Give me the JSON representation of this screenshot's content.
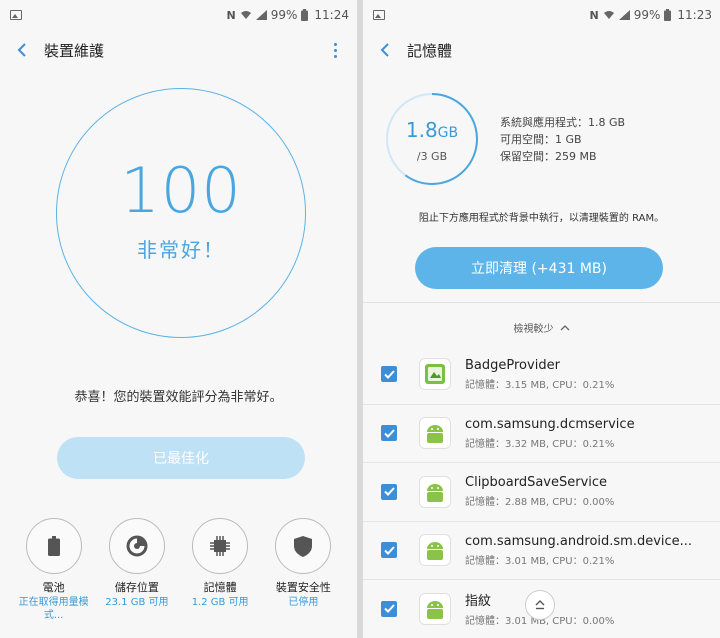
{
  "left": {
    "status": {
      "battery_pct": "99%",
      "time": "11:24"
    },
    "title": "裝置維護",
    "score": "100",
    "score_word": "非常好！",
    "congrats": "恭喜！您的裝置效能評分為非常好。",
    "optimize_label": "已最佳化",
    "categories": [
      {
        "label": "電池",
        "sub": "正在取得用量模式...",
        "icon": "battery-icon"
      },
      {
        "label": "儲存位置",
        "sub": "23.1 GB 可用",
        "icon": "storage-icon"
      },
      {
        "label": "記憶體",
        "sub": "1.2 GB 可用",
        "icon": "memory-chip-icon"
      },
      {
        "label": "裝置安全性",
        "sub": "已停用",
        "icon": "shield-icon"
      }
    ]
  },
  "right": {
    "status": {
      "battery_pct": "99%",
      "time": "11:23"
    },
    "title": "記憶體",
    "used_value": "1.8",
    "used_unit": "GB",
    "total": "/3 GB",
    "used_fraction": 0.6,
    "info": [
      "系統與應用程式：1.8 GB",
      "可用空間：1 GB",
      "保留空間：259 MB"
    ],
    "note": "阻止下方應用程式於背景中執行，以清理裝置的 RAM。",
    "clean_label": "立即清理 (+431 MB)",
    "view_less": "檢視較少",
    "apps": [
      {
        "name": "BadgeProvider",
        "detail": "記憶體：3.15 MB, CPU：0.21%",
        "icon": "badge-provider-icon",
        "checked": true
      },
      {
        "name": "com.samsung.dcmservice",
        "detail": "記憶體：3.32 MB, CPU：0.21%",
        "icon": "android-icon",
        "checked": true
      },
      {
        "name": "ClipboardSaveService",
        "detail": "記憶體：2.88 MB, CPU：0.00%",
        "icon": "android-icon",
        "checked": true
      },
      {
        "name": "com.samsung.android.sm.device...",
        "detail": "記憶體：3.01 MB, CPU：0.21%",
        "icon": "android-icon",
        "checked": true
      },
      {
        "name": "指紋",
        "detail": "記憶體：3.01 MB, CPU：0.00%",
        "icon": "android-icon",
        "checked": true
      }
    ]
  },
  "colors": {
    "accent": "#4aa6df",
    "button": "#5cb4e8",
    "button_disabled": "#bfe1f5",
    "checkbox": "#3c8fd6"
  }
}
